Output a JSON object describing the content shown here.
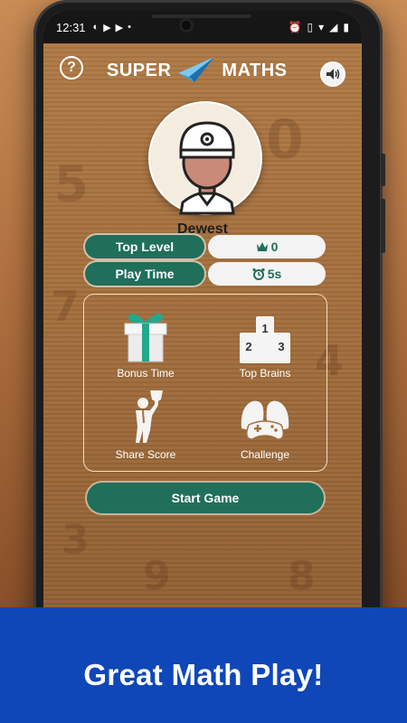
{
  "statusbar": {
    "time": "12:31"
  },
  "header": {
    "logo_left": "SUPER",
    "logo_right": "MATHS",
    "help_symbol": "?",
    "sound_icon": "speaker-icon"
  },
  "profile": {
    "username": "Dewest"
  },
  "stats": {
    "top_level_label": "Top Level",
    "top_level_value": "0",
    "play_time_label": "Play Time",
    "play_time_value": "5s"
  },
  "menu": {
    "bonus_time": "Bonus Time",
    "top_brains": "Top Brains",
    "share_score": "Share Score",
    "challenge": "Challenge",
    "podium_numbers": [
      "1",
      "2",
      "3"
    ]
  },
  "start_button": "Start Game",
  "tagline": "Great Math Play!",
  "colors": {
    "accent": "#1f6f5b",
    "banner": "#0f47b8",
    "wood": "#a5703e"
  }
}
